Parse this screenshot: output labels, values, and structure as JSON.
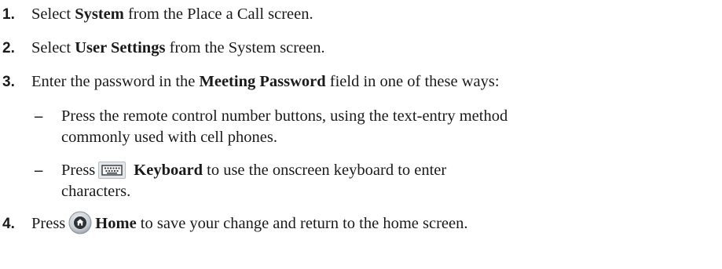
{
  "steps": [
    {
      "number": "1.",
      "pre": "Select ",
      "bold": "System",
      "post": " from the Place a Call screen."
    },
    {
      "number": "2.",
      "pre": "Select ",
      "bold": "User Settings",
      "post": " from the System screen."
    },
    {
      "number": "3.",
      "pre": "Enter the password in the ",
      "bold": "Meeting Password",
      "post": " field in one of these ways:",
      "sub_items": [
        {
          "dash": "–",
          "line1": "Press the remote control number buttons, using the text-entry method",
          "line2": "commonly used with cell phones."
        },
        {
          "dash": "–",
          "pre": "Press",
          "icon": "keyboard-icon",
          "bold": "Keyboard",
          "post": " to use the onscreen keyboard to enter",
          "line2": "characters."
        }
      ]
    },
    {
      "number": "4.",
      "pre": "Press",
      "icon": "home-button-icon",
      "bold": "Home",
      "post": " to save your change and return to the home screen."
    }
  ],
  "colors": {
    "text": "#1a1a1a",
    "keyboard_icon_bg": "#e4e6e8",
    "home_icon_bg": "#c9cfd4"
  }
}
